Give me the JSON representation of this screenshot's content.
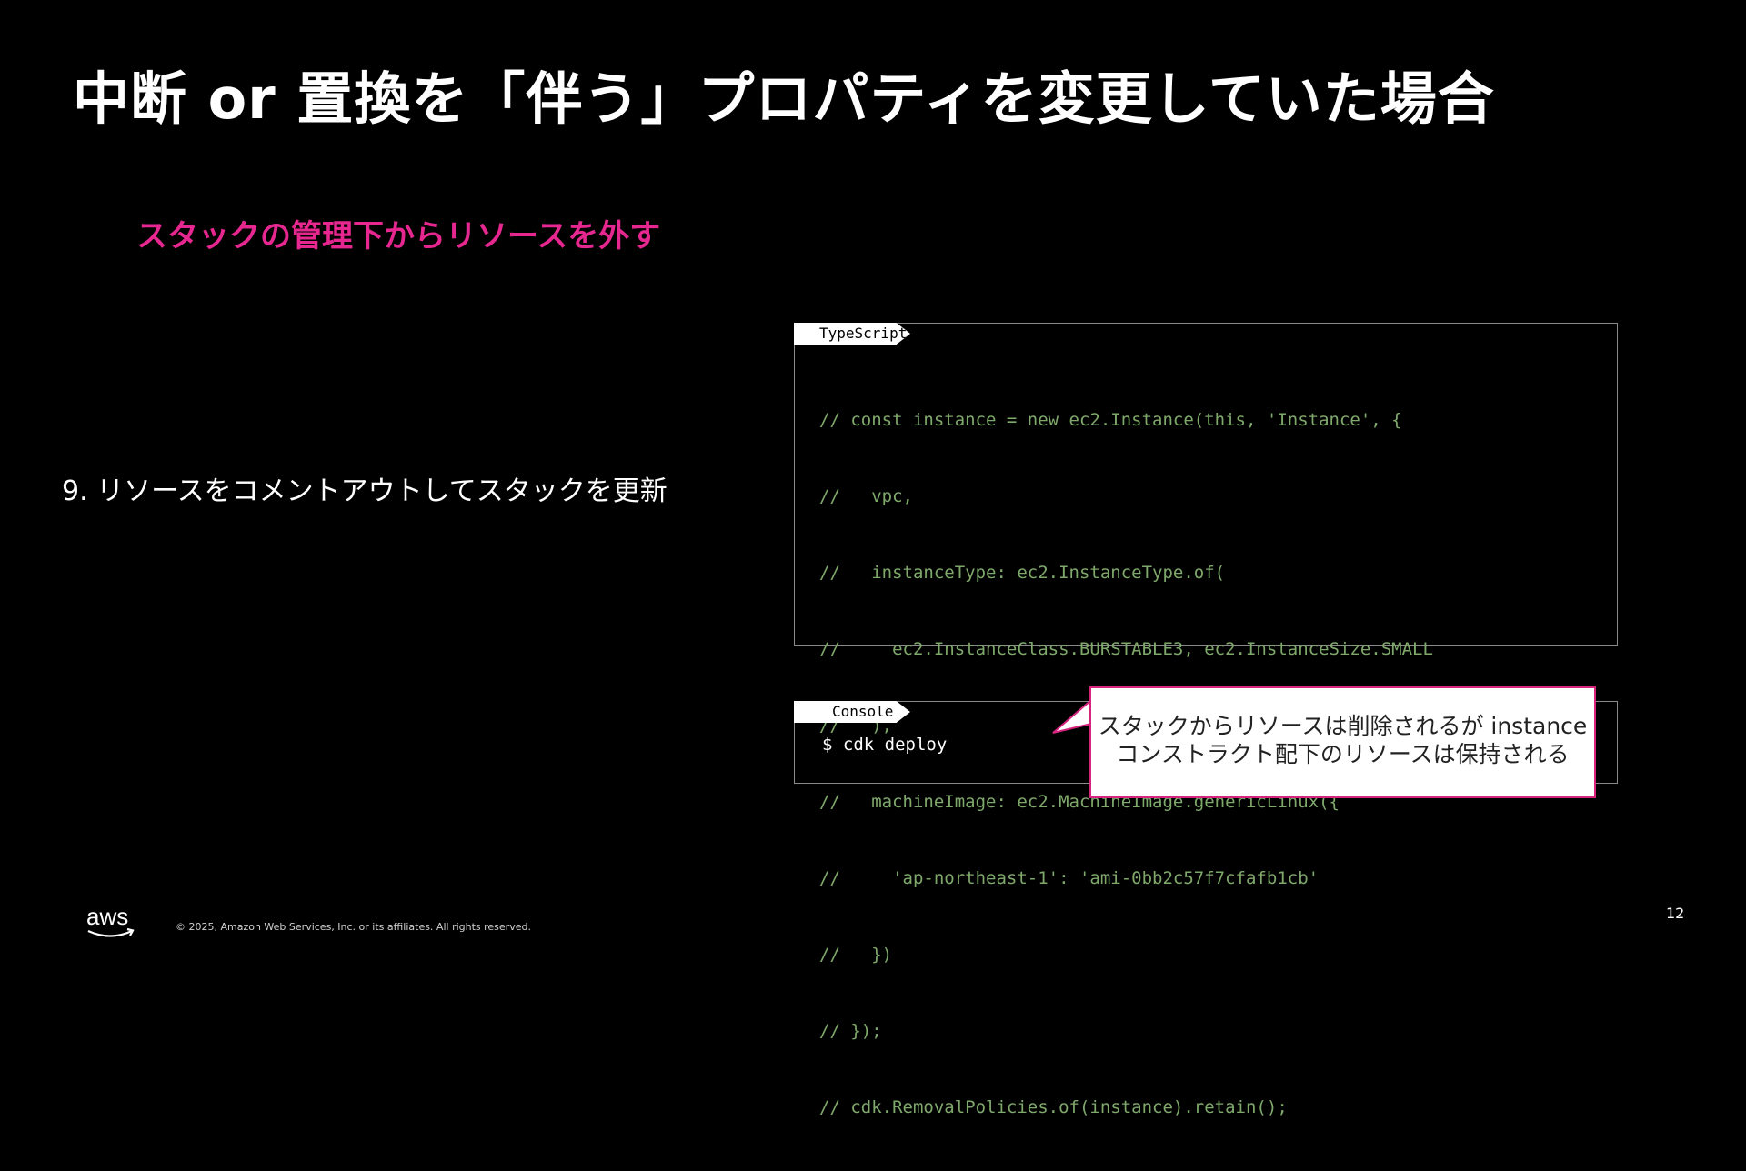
{
  "slide": {
    "title": "中断 or 置換を「伴う」プロパティを変更していた場合",
    "subtitle": "スタックの管理下からリソースを外す",
    "step": "9. リソースをコメントアウトしてスタックを更新"
  },
  "code": {
    "label": "TypeScript",
    "lines": [
      "// const instance = new ec2.Instance(this, 'Instance', {",
      "//   vpc,",
      "//   instanceType: ec2.InstanceType.of(",
      "//     ec2.InstanceClass.BURSTABLE3, ec2.InstanceSize.SMALL",
      "//   ),",
      "//   machineImage: ec2.MachineImage.genericLinux({",
      "//     'ap-northeast-1': 'ami-0bb2c57f7cfafb1cb'",
      "//   })",
      "// });",
      "// cdk.RemovalPolicies.of(instance).retain();"
    ],
    "color": "#7fa86b"
  },
  "console": {
    "label": "Console",
    "command": "$ cdk deploy"
  },
  "callout": {
    "line1": "スタックからリソースは削除されるが instance",
    "line2": "コンストラクト配下のリソースは保持される",
    "border_color": "#d6247f"
  },
  "footer": {
    "logo_text": "aws",
    "copyright": "© 2025, Amazon Web Services, Inc. or its affiliates. All rights reserved.",
    "page_number": "12"
  },
  "colors": {
    "background": "#000000",
    "accent": "#e6278f"
  }
}
